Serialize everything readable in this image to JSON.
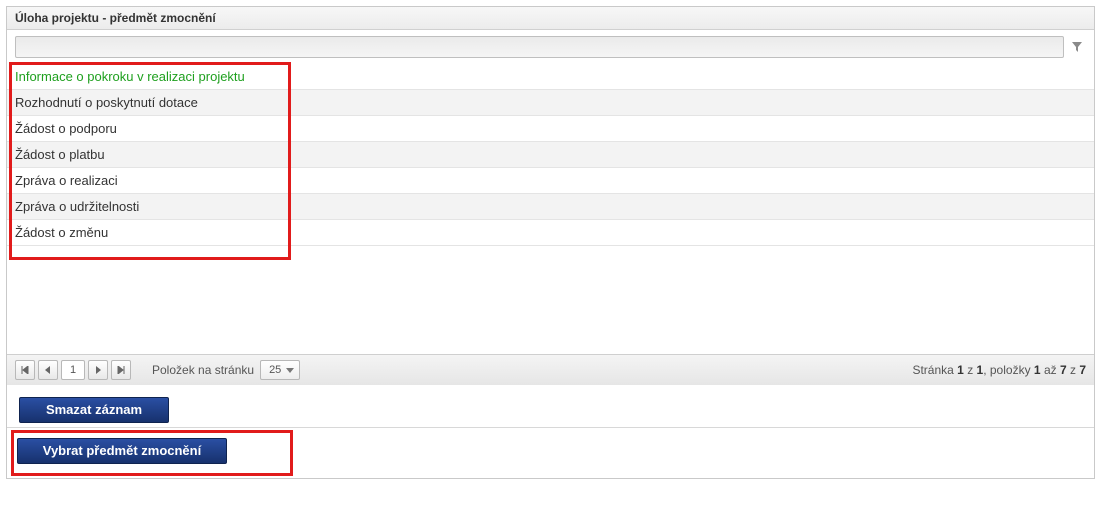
{
  "panel": {
    "title": "Úloha projektu - předmět zmocnění"
  },
  "filter": {
    "value": ""
  },
  "rows": [
    {
      "label": "Informace o pokroku v realizaci projektu",
      "selected": true
    },
    {
      "label": "Rozhodnutí o poskytnutí dotace",
      "selected": false
    },
    {
      "label": "Žádost o podporu",
      "selected": false
    },
    {
      "label": "Žádost o platbu",
      "selected": false
    },
    {
      "label": "Zpráva o realizaci",
      "selected": false
    },
    {
      "label": "Zpráva o udržitelnosti",
      "selected": false
    },
    {
      "label": "Žádost o změnu",
      "selected": false
    }
  ],
  "pager": {
    "page": "1",
    "per_page_label": "Položek na stránku",
    "per_page": "25",
    "summary_prefix": "Stránka ",
    "summary_page_cur": "1",
    "summary_mid1": " z ",
    "summary_page_tot": "1",
    "summary_mid2": ", položky ",
    "summary_item_from": "1",
    "summary_mid3": " až ",
    "summary_item_to": "7",
    "summary_mid4": " z ",
    "summary_item_total": "7"
  },
  "buttons": {
    "delete": "Smazat záznam",
    "select_subject": "Vybrat předmět zmocnění"
  }
}
